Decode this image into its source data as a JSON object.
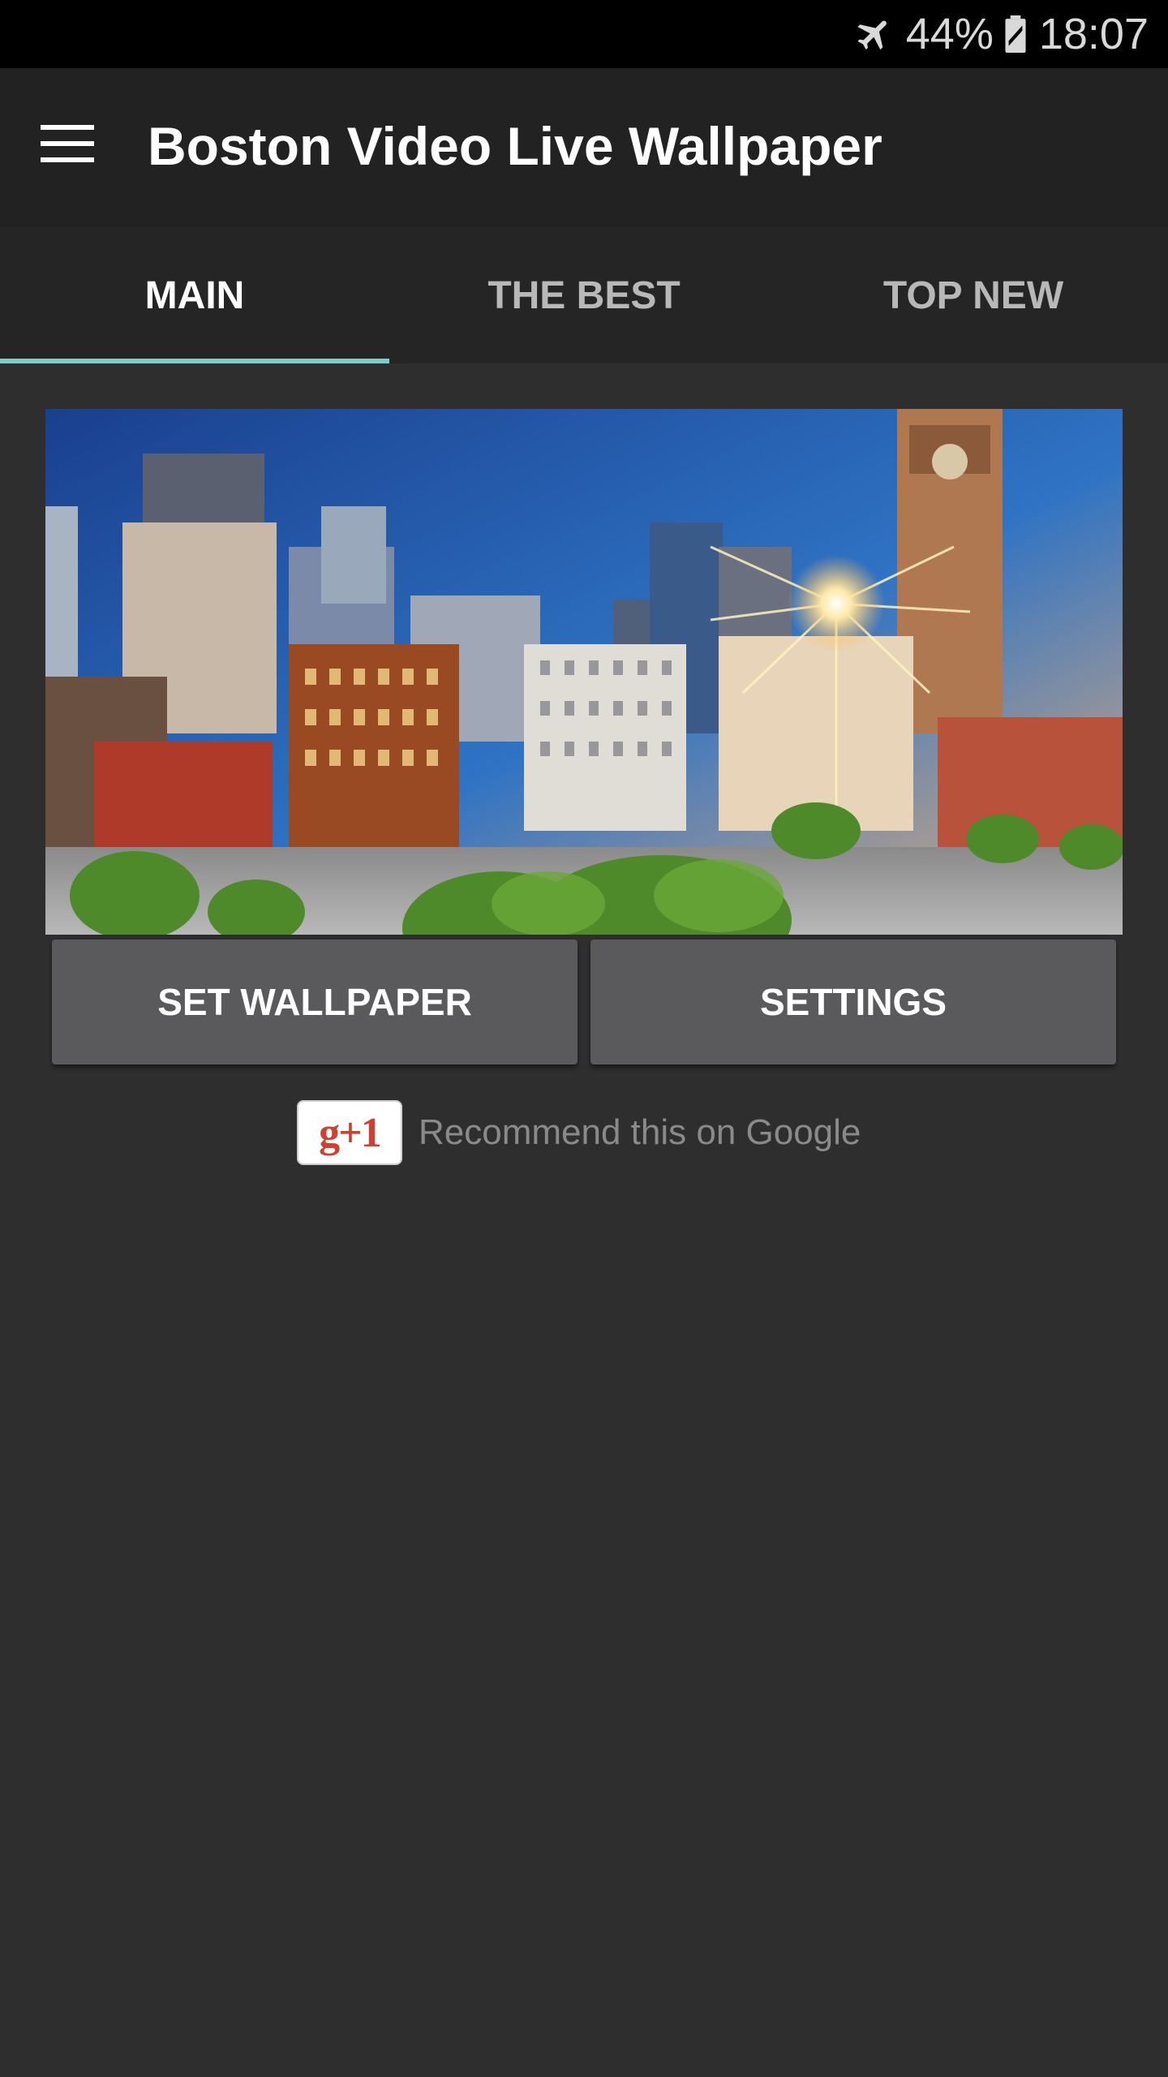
{
  "status_bar": {
    "battery_percent": "44%",
    "time": "18:07",
    "icons": [
      "airplane-icon",
      "battery-icon"
    ]
  },
  "app_bar": {
    "title": "Boston Video Live Wallpaper",
    "menu_icon": "menu-icon"
  },
  "tabs": [
    {
      "label": "MAIN",
      "active": true
    },
    {
      "label": "THE BEST",
      "active": false
    },
    {
      "label": "TOP NEW",
      "active": false
    }
  ],
  "actions": {
    "set_wallpaper_label": "SET WALLPAPER",
    "settings_label": "SETTINGS"
  },
  "google_plus": {
    "badge_label": "g+1",
    "text": "Recommend this on Google"
  },
  "colors": {
    "background": "#2e2e2e",
    "app_bar": "#222222",
    "tab_indicator": "#80cbc4",
    "button": "#5a5a5c",
    "gplus_red": "#d23f31"
  }
}
